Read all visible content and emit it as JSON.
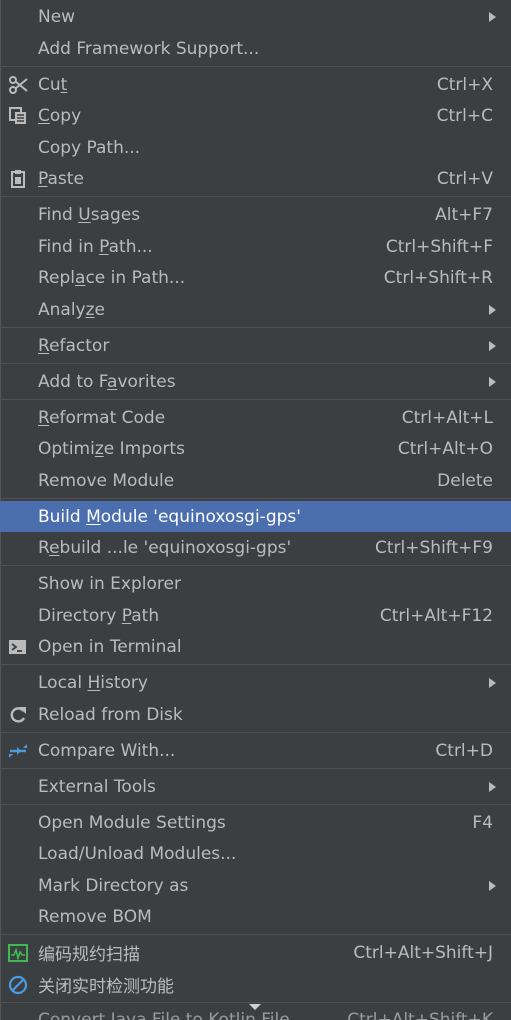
{
  "menu": {
    "new": {
      "label": "New"
    },
    "add_framework": {
      "label": "Add Framework Support..."
    },
    "cut": {
      "label_pre": "Cu",
      "label_u": "t",
      "label_post": "",
      "shortcut": "Ctrl+X"
    },
    "copy": {
      "label_pre": "",
      "label_u": "C",
      "label_post": "opy",
      "shortcut": "Ctrl+C"
    },
    "copy_path": {
      "label": "Copy Path..."
    },
    "paste": {
      "label_pre": "",
      "label_u": "P",
      "label_post": "aste",
      "shortcut": "Ctrl+V"
    },
    "find_usages": {
      "label_pre": "Find ",
      "label_u": "U",
      "label_post": "sages",
      "shortcut": "Alt+F7"
    },
    "find_in_path": {
      "label_pre": "Find in ",
      "label_u": "P",
      "label_post": "ath...",
      "shortcut": "Ctrl+Shift+F"
    },
    "replace_in_path": {
      "label_pre": "Repl",
      "label_u": "a",
      "label_post": "ce in Path...",
      "shortcut": "Ctrl+Shift+R"
    },
    "analyze": {
      "label_pre": "Analy",
      "label_u": "z",
      "label_post": "e"
    },
    "refactor": {
      "label_pre": "",
      "label_u": "R",
      "label_post": "efactor"
    },
    "add_to_favorites": {
      "label_pre": "Add to F",
      "label_u": "a",
      "label_post": "vorites"
    },
    "reformat_code": {
      "label_pre": "",
      "label_u": "R",
      "label_post": "eformat Code",
      "shortcut": "Ctrl+Alt+L"
    },
    "optimize_imports": {
      "label_pre": "Optimi",
      "label_u": "z",
      "label_post": "e Imports",
      "shortcut": "Ctrl+Alt+O"
    },
    "remove_module": {
      "label": "Remove Module",
      "shortcut": "Delete"
    },
    "build_module": {
      "label_pre": "Build ",
      "label_u": "M",
      "label_post": "odule 'equinoxosgi-gps'"
    },
    "rebuild_module": {
      "label_pre": "R",
      "label_u": "e",
      "label_post": "build ...le 'equinoxosgi-gps'",
      "shortcut": "Ctrl+Shift+F9"
    },
    "show_in_explorer": {
      "label": "Show in Explorer"
    },
    "directory_path": {
      "label_pre": "Directory ",
      "label_u": "P",
      "label_post": "ath",
      "shortcut": "Ctrl+Alt+F12"
    },
    "open_in_terminal": {
      "label": "Open in Terminal"
    },
    "local_history": {
      "label_pre": "Local ",
      "label_u": "H",
      "label_post": "istory"
    },
    "reload_from_disk": {
      "label": "Reload from Disk"
    },
    "compare_with": {
      "label": "Compare With...",
      "shortcut": "Ctrl+D"
    },
    "external_tools": {
      "label": "External Tools"
    },
    "open_module_settings": {
      "label": "Open Module Settings",
      "shortcut": "F4"
    },
    "load_unload_modules": {
      "label": "Load/Unload Modules..."
    },
    "mark_directory_as": {
      "label": "Mark Directory as"
    },
    "remove_bom": {
      "label": "Remove BOM"
    },
    "code_scan": {
      "label": "编码规约扫描",
      "shortcut": "Ctrl+Alt+Shift+J"
    },
    "close_realtime": {
      "label": "关闭实时检测功能"
    },
    "convert_kotlin": {
      "label": "Convert Java File to Kotlin File",
      "shortcut": "Ctrl+Alt+Shift+K"
    }
  },
  "colors": {
    "background": "#3c3f41",
    "selected": "#4b6eaf",
    "text": "#bbbbbb",
    "separator": "#515151"
  }
}
